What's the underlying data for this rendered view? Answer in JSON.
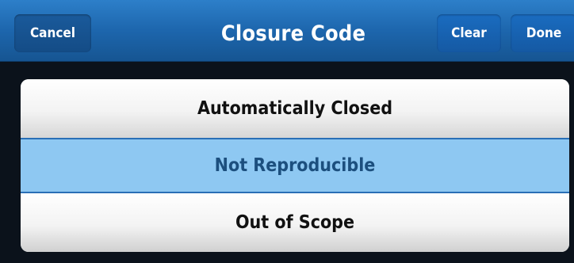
{
  "header": {
    "title": "Closure Code",
    "cancel_label": "Cancel",
    "clear_label": "Clear",
    "done_label": "Done"
  },
  "options": [
    {
      "label": "Automatically Closed",
      "selected": false
    },
    {
      "label": "Not Reproducible",
      "selected": true
    },
    {
      "label": "Out of Scope",
      "selected": false
    }
  ],
  "colors": {
    "header_blue": "#1d66ad",
    "selected_row": "#8ec8f2",
    "selected_text": "#1c4f7e",
    "background": "#0b121b"
  }
}
